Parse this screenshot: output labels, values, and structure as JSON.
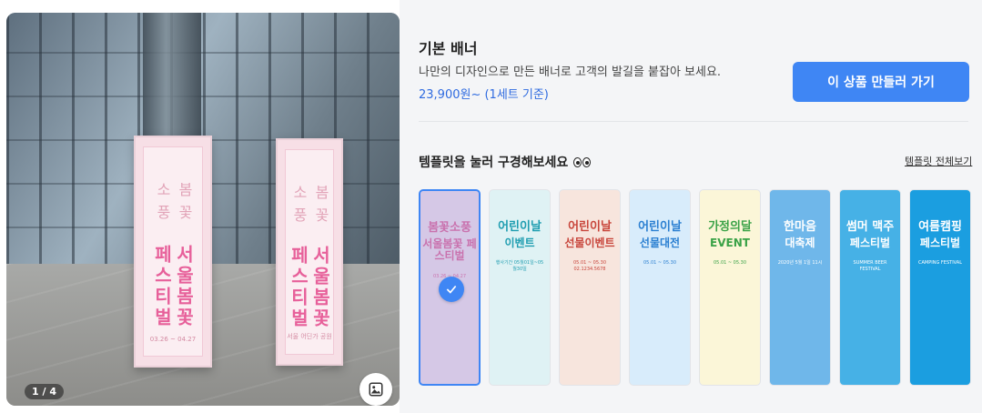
{
  "gallery": {
    "counter": "1 / 4",
    "banner_small": "봄 꽃 소 풍",
    "banner_large": "서울봄꽃 페스티벌",
    "banner_date": "03.26 ~ 04.27",
    "banner_place": "서울 어딘가 공원",
    "zoom_icon": "image-icon"
  },
  "product": {
    "title": "기본 배너",
    "description": "나만의 디자인으로 만든 배너로 고객의 발길을 붙잡아 보세요.",
    "price": "23,900원~ (1세트 기준)",
    "cta_label": "이 상품 만들러 가기"
  },
  "templates": {
    "heading": "템플릿을 눌러 구경해보세요",
    "view_all": "템플릿 전체보기",
    "items": [
      {
        "line1": "봄꽃소풍",
        "line2": "서울봄꽃 페스티벌",
        "sub": "03.26 ~ 04.27",
        "bg": "#f5dde6",
        "fg": "#e56a9b",
        "selected": true
      },
      {
        "line1": "어린이날",
        "line2": "이벤트",
        "sub": "행사기간 05월01일~05월30일",
        "bg": "#dff2f4",
        "fg": "#1e9db0",
        "selected": false
      },
      {
        "line1": "어린이날",
        "line2": "선물이벤트",
        "sub": "05.01 ~ 05.30 02.1234.5678",
        "bg": "#f7e5dd",
        "fg": "#c8453b",
        "selected": false
      },
      {
        "line1": "어린이날",
        "line2": "선물대전",
        "sub": "05.01 ~ 05.30",
        "bg": "#d8ecfb",
        "fg": "#2a7fd1",
        "selected": false
      },
      {
        "line1": "가정의달",
        "line2": "EVENT",
        "sub": "05.01 ~ 05.30",
        "bg": "#fbf6d8",
        "fg": "#3aa247",
        "selected": false
      },
      {
        "line1": "한마음",
        "line2": "대축제",
        "sub": "2020년 5월 1일 11시",
        "bg": "#6fb7ea",
        "fg": "#ffffff",
        "selected": false
      },
      {
        "line1": "썸머 맥주",
        "line2": "페스티벌",
        "sub": "SUMMER BEER FESTIVAL",
        "bg": "#46b1e6",
        "fg": "#ffffff",
        "selected": false
      },
      {
        "line1": "여름캠핑",
        "line2": "페스티벌",
        "sub": "CAMPING FESTIVAL",
        "bg": "#1b9ee0",
        "fg": "#ffffff",
        "selected": false
      }
    ]
  },
  "colors": {
    "accent": "#3f86f4",
    "panel_bg": "#f4f5f7"
  }
}
